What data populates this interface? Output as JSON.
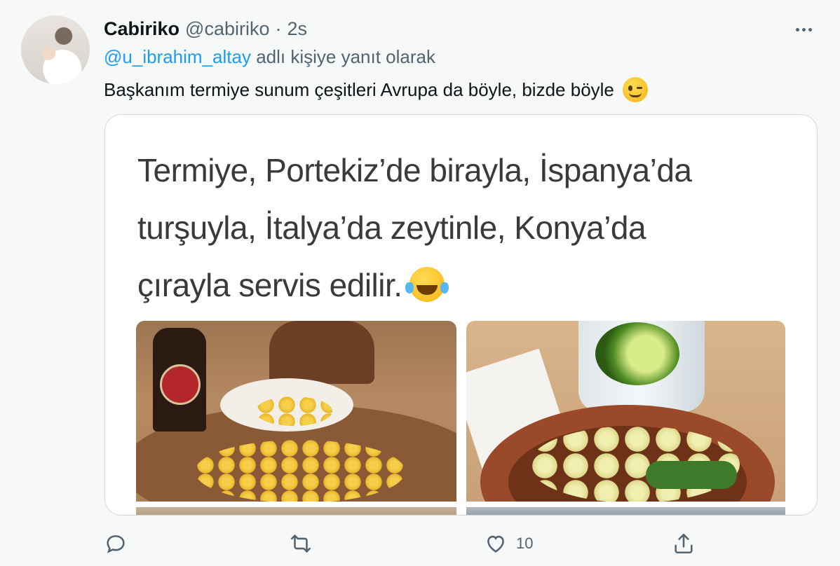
{
  "author": {
    "display_name": "Cabiriko",
    "handle": "@cabiriko",
    "separator": "·",
    "time": "2s"
  },
  "reply": {
    "handle": "@u_ibrahim_altay",
    "suffix": "adlı kişiye yanıt olarak"
  },
  "tweet": {
    "text": "Başkanım termiye sunum çeşitleri Avrupa da böyle, bizde böyle",
    "emoji": "winking-face"
  },
  "media": {
    "caption_lines": [
      "Termiye, Portekiz’de birayla, İspanya’da",
      "turşuyla, İtalya’da zeytinle, Konya’da",
      "çırayla servis edilir."
    ],
    "caption_emoji": "face-with-tears-of-joy",
    "photos": [
      "beer-and-lupini-beans",
      "lupini-beans-with-pickles"
    ],
    "bottle_label": "SUPER BOCK"
  },
  "actions": {
    "reply_count": "",
    "retweet_count": "",
    "like_count": "10",
    "share_label": ""
  },
  "colors": {
    "link": "#1d9bf0",
    "secondary_text": "#536471",
    "background": "#f7f9f9"
  }
}
